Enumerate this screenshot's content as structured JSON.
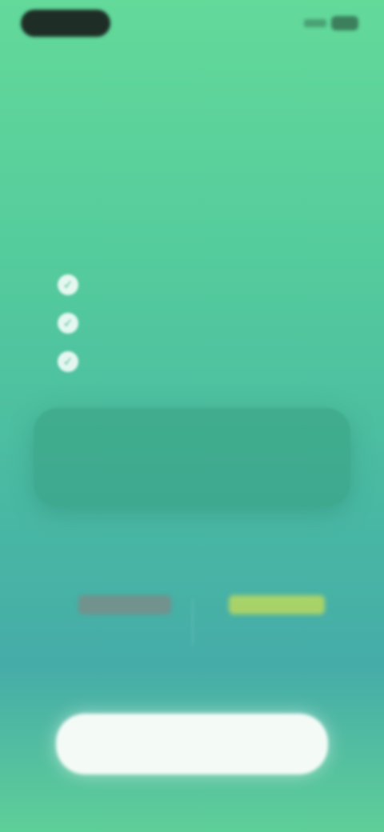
{
  "status_bar": {
    "left_icon": "status-pill",
    "right_icons": [
      "signal-icon",
      "battery-icon"
    ]
  },
  "paywall": {
    "kicker": "",
    "headline": "",
    "features": [
      {
        "icon": "check-icon",
        "text": ""
      },
      {
        "icon": "check-icon",
        "text": ""
      },
      {
        "icon": "check-icon",
        "text": ""
      }
    ],
    "plan": {
      "title": "",
      "subtitle": ""
    },
    "prompt": "",
    "options": [
      {
        "label": "",
        "color": "#967878"
      },
      {
        "label": "",
        "color": "#d2e150"
      }
    ],
    "cta_label": ""
  },
  "colors": {
    "background_top": "#63d99a",
    "background_mid": "#46aca8",
    "card": "#34967a",
    "cta_bg": "#f4fbf7",
    "cta_text": "#b8c6d8"
  }
}
